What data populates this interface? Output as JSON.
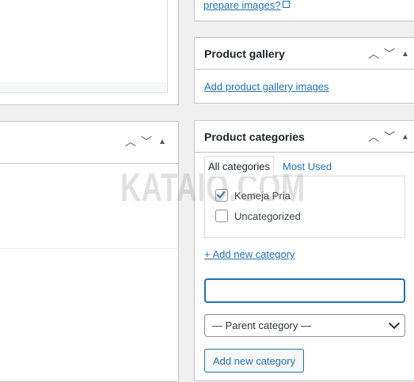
{
  "top_box": {
    "link_text": "prepare images?"
  },
  "gallery": {
    "title": "Product gallery",
    "add_link": "Add product gallery images"
  },
  "categories": {
    "title": "Product categories",
    "tabs": [
      {
        "label": "All categories",
        "active": true
      },
      {
        "label": "Most Used",
        "active": false
      }
    ],
    "items": [
      {
        "label": "Kemeja Pria",
        "checked": true
      },
      {
        "label": "Uncategorized",
        "checked": false
      }
    ],
    "add_new_toggle": "+ Add new category",
    "new_category_value": "",
    "parent_select": "— Parent category —",
    "add_button": "Add new category"
  },
  "header_controls": {
    "up": "chevron-up-icon",
    "down": "chevron-down-icon",
    "toggle": "triangle-up-icon"
  },
  "watermark": "KATAIO.COM",
  "colors": {
    "link": "#2271b1",
    "border": "#c3c4c7",
    "background": "#f0f0f1"
  }
}
